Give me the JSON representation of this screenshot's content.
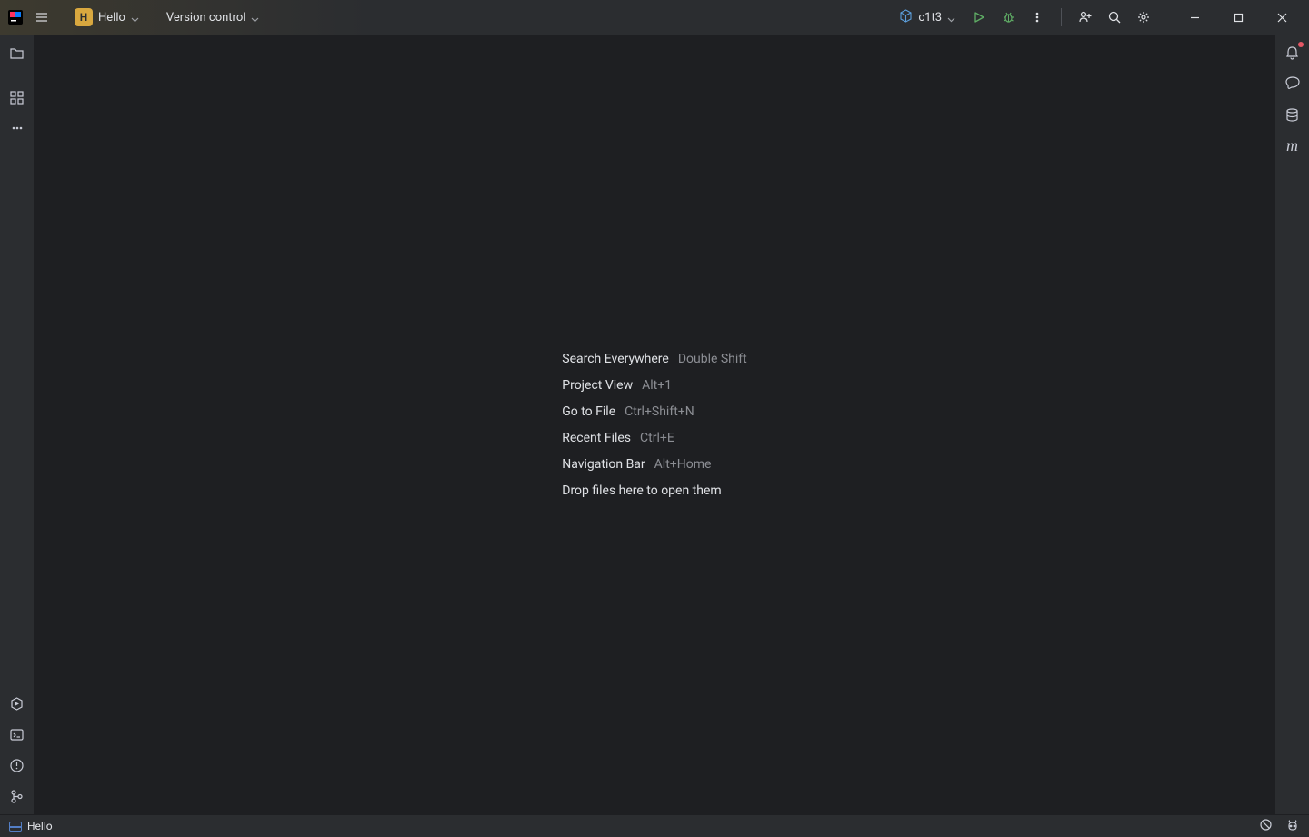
{
  "titlebar": {
    "project_letter": "H",
    "project_name": "Hello",
    "version_control_label": "Version control",
    "run_config_label": "c1t3"
  },
  "hints": {
    "search_everywhere": {
      "label": "Search Everywhere",
      "shortcut": "Double Shift"
    },
    "project_view": {
      "label": "Project View",
      "shortcut": "Alt+1"
    },
    "go_to_file": {
      "label": "Go to File",
      "shortcut": "Ctrl+Shift+N"
    },
    "recent_files": {
      "label": "Recent Files",
      "shortcut": "Ctrl+E"
    },
    "navigation_bar": {
      "label": "Navigation Bar",
      "shortcut": "Alt+Home"
    },
    "drop_hint": "Drop files here to open them"
  },
  "statusbar": {
    "project_status": "Hello"
  },
  "colors": {
    "accent_yellow": "#d9a83f",
    "run_green": "#5fad65",
    "notif_red": "#e55765",
    "bg_editor": "#1e1f22",
    "bg_panel": "#2b2d30"
  }
}
